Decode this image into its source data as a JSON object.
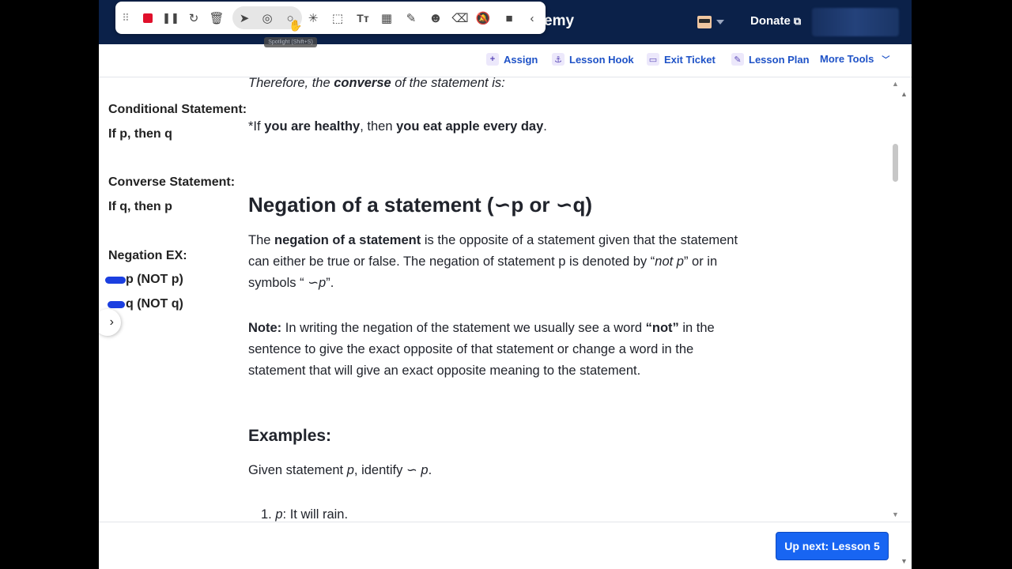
{
  "header": {
    "brand_fragment": "emy",
    "donate_label": "Donate",
    "external_glyph": "⧉"
  },
  "toolbar": {
    "tooltip": "Spotlight (Shift+S)"
  },
  "tools": {
    "assign": "Assign",
    "lesson_hook": "Lesson Hook",
    "exit_ticket": "Exit Ticket",
    "lesson_plan": "Lesson Plan",
    "more_tools": "More Tools"
  },
  "notes": {
    "conditional_title": "Conditional Statement:",
    "conditional_form": "If p, then q",
    "converse_title": "Converse Statement:",
    "converse_form": "If q, then p",
    "negation_title": "Negation EX:",
    "negation_p": "p  (NOT p)",
    "negation_q": "q (NOT q)"
  },
  "article": {
    "converse_intro_pre": "Therefore, the ",
    "converse_intro_bold": "converse",
    "converse_intro_post": " of the statement is:",
    "converse_line_pre": "*If ",
    "converse_line_b1": "you are healthy",
    "converse_line_mid": ", then ",
    "converse_line_b2": "you eat apple every day",
    "converse_line_end": ".",
    "neg_heading": "Negation of a statement (∽p or ∽q)",
    "neg_para_pre": "The ",
    "neg_para_bold": "negation of a statement",
    "neg_para_mid": " is the opposite of a statement given that the statement can either be true or false. The negation of statement p is denoted by “",
    "neg_para_it1": "not p",
    "neg_para_mid2": "” or in symbols “ ",
    "neg_para_it2": "∽p",
    "neg_para_end": "”.",
    "note_bold": "Note:",
    "note_text1": " In writing the negation of the statement we usually see a word ",
    "note_not": "“not”",
    "note_text2": " in the sentence to give the exact opposite of that statement or change a word in the statement that will give an exact opposite meaning to the statement.",
    "examples_heading": "Examples:",
    "given_pre": "Given statement ",
    "given_p": "p",
    "given_mid": ", identify ",
    "given_np": "∽ p",
    "given_end": ".",
    "item1_num": "1.",
    "item1_var": "p",
    "item1_text": ": It will rain."
  },
  "footer": {
    "up_next": "Up next: Lesson 5"
  },
  "colors": {
    "header_bg": "#0b2149",
    "link_blue": "#1e52c7",
    "button_blue": "#1865f2",
    "record_red": "#e0102b",
    "scribble_blue": "#1b3fe0"
  }
}
